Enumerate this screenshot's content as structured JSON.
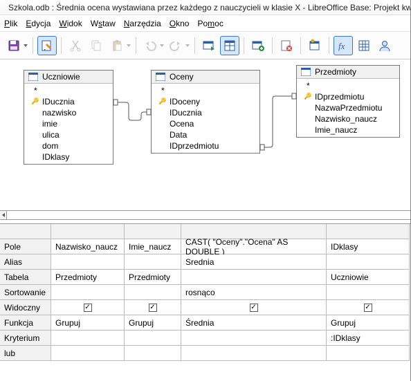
{
  "window": {
    "title": "Szkola.odb : Średnia ocena wystawiana przez każdego z nauczycieli w klasie X - LibreOffice Base: Projekt kwe"
  },
  "menu": {
    "file": "Plik",
    "edit": "Edycja",
    "view": "Widok",
    "insert": "Wstaw",
    "tools": "Narzędzia",
    "window": "Okno",
    "help": "Pomoc"
  },
  "tables": {
    "uczniowie": {
      "title": "Uczniowie",
      "fields": [
        "*",
        "IDucznia",
        "nazwisko",
        "imie",
        "ulica",
        "dom",
        "IDklasy"
      ],
      "keys": [
        1
      ]
    },
    "oceny": {
      "title": "Oceny",
      "fields": [
        "*",
        "IDoceny",
        "IDucznia",
        "Ocena",
        "Data",
        "IDprzedmiotu"
      ],
      "keys": [
        1
      ]
    },
    "przedmioty": {
      "title": "Przedmioty",
      "fields": [
        "*",
        "IDprzedmiotu",
        "NazwaPrzedmiotu",
        "Nazwisko_naucz",
        "Imie_naucz"
      ],
      "keys": [
        1
      ]
    }
  },
  "grid": {
    "rowheads": {
      "pole": "Pole",
      "alias": "Alias",
      "tabela": "Tabela",
      "sortowanie": "Sortowanie",
      "widoczny": "Widoczny",
      "funkcja": "Funkcja",
      "kryterium": "Kryterium",
      "lub": "lub"
    },
    "cols": [
      {
        "pole": "Nazwisko_naucz",
        "alias": "",
        "tabela": "Przedmioty",
        "sortowanie": "",
        "widoczny": true,
        "funkcja": "Grupuj",
        "kryterium": ""
      },
      {
        "pole": "Imie_naucz",
        "alias": "",
        "tabela": "Przedmioty",
        "sortowanie": "",
        "widoczny": true,
        "funkcja": "Grupuj",
        "kryterium": ""
      },
      {
        "pole": "CAST( \"Oceny\".\"Ocena\" AS DOUBLE )",
        "alias": "Srednia",
        "tabela": "",
        "sortowanie": "rosnąco",
        "widoczny": true,
        "funkcja": "Średnia",
        "kryterium": ""
      },
      {
        "pole": "IDklasy",
        "alias": "",
        "tabela": "Uczniowie",
        "sortowanie": "",
        "widoczny": true,
        "funkcja": "Grupuj",
        "kryterium": ":IDklasy"
      }
    ]
  }
}
